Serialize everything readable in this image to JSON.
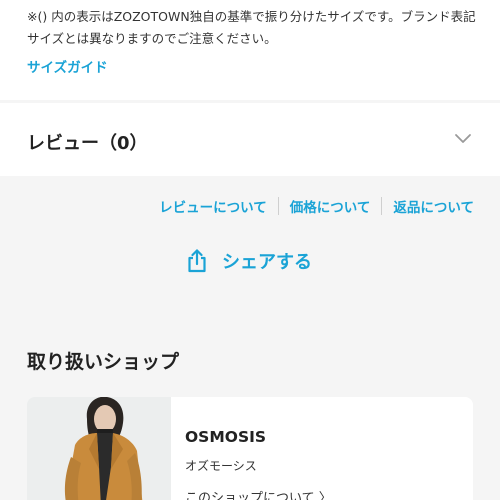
{
  "size_info": {
    "note": "※() 内の表示はZOZOTOWN独自の基準で振り分けたサイズです。ブランド表記サイズとは異なりますのでご注意ください。",
    "guide_link": "サイズガイド"
  },
  "review": {
    "title": "レビュー（0）"
  },
  "info_links": [
    "レビューについて",
    "価格について",
    "返品について"
  ],
  "share": {
    "label": "シェアする"
  },
  "shop_section": {
    "heading": "取り扱いショップ",
    "shop_name": "OSMOSIS",
    "shop_kana": "オズモーシス",
    "shop_link": "このショップについて 〉"
  },
  "colors": {
    "accent": "#1aa3d6",
    "page_background": "#f5f5f5"
  }
}
